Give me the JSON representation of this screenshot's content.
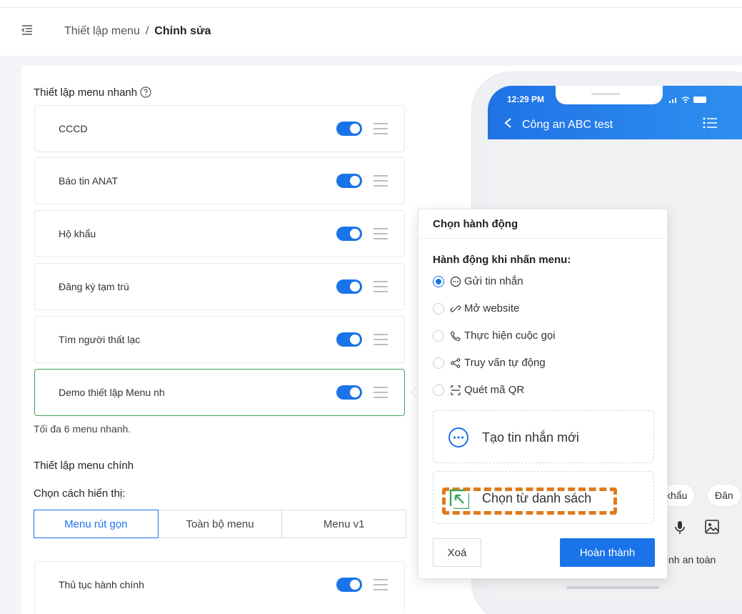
{
  "breadcrumb": {
    "parent": "Thiết lập menu",
    "separator": "/",
    "current": "Chỉnh sửa"
  },
  "quick_menu": {
    "title": "Thiết lập menu nhanh",
    "items": [
      {
        "label": "CCCD",
        "enabled": true
      },
      {
        "label": "Báo tin ANAT",
        "enabled": true
      },
      {
        "label": "Hộ khẩu",
        "enabled": true
      },
      {
        "label": "Đăng ký tạm trú",
        "enabled": true
      },
      {
        "label": "Tìm người thất lạc",
        "enabled": true
      },
      {
        "label": "Demo thiết lập Menu nh",
        "enabled": true
      }
    ],
    "hint": "Tối đa 6 menu nhanh."
  },
  "main_menu": {
    "title": "Thiết lập menu chính",
    "display_label": "Chọn cách hiển thị:",
    "modes": [
      "Menu rút gọn",
      "Toàn bộ menu",
      "Menu v1"
    ],
    "selected_mode": "Menu rút gọn",
    "items": [
      {
        "label": "Thủ tục hành chính",
        "enabled": true
      }
    ]
  },
  "phone": {
    "time": "12:29 PM",
    "title": "Công an ABC test",
    "chips": [
      "khẩu",
      "Đăn"
    ],
    "bottom_text": "inh an toàn"
  },
  "popover": {
    "title": "Chọn hành động",
    "subtitle": "Hành động khi nhấn menu:",
    "options": [
      "Gửi tin nhắn",
      "Mở website",
      "Thực hiện cuộc gọi",
      "Truy vấn tự động",
      "Quét mã QR"
    ],
    "selected": "Gửi tin nhắn",
    "card_new": "Tạo tin nhắn mới",
    "card_list": "Chọn từ danh sách",
    "delete_label": "Xoá",
    "done_label": "Hoàn thành"
  },
  "colors": {
    "accent": "#1a73e8",
    "active_border": "#3aa65a",
    "highlight": "#e07a1c"
  }
}
